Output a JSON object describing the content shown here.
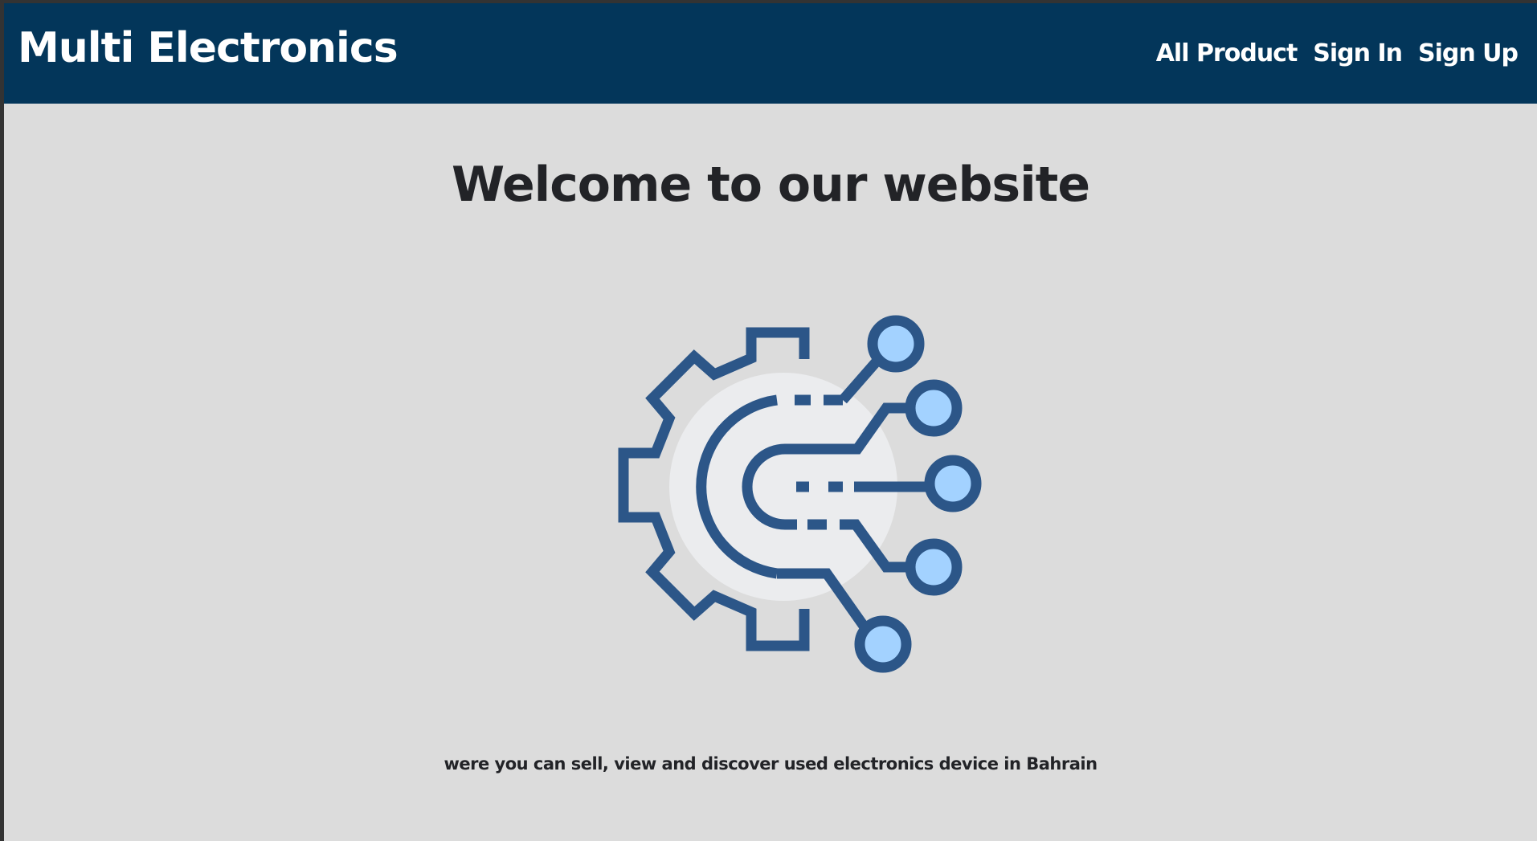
{
  "navbar": {
    "brand": "Multi Electronics",
    "links": [
      {
        "label": "All Product"
      },
      {
        "label": "Sign In"
      },
      {
        "label": "Sign Up"
      }
    ]
  },
  "hero": {
    "title": "Welcome to our website",
    "icon": "gear-circuit-icon",
    "tagline": "were you can sell, view and discover used electronics device in Bahrain"
  },
  "colors": {
    "navbar_bg": "#03365a",
    "page_bg": "#dcdcdc",
    "text_dark": "#222327",
    "icon_stroke": "#2c5688",
    "icon_node_fill": "#a3d2ff",
    "icon_circle_fill": "#ebecee"
  }
}
